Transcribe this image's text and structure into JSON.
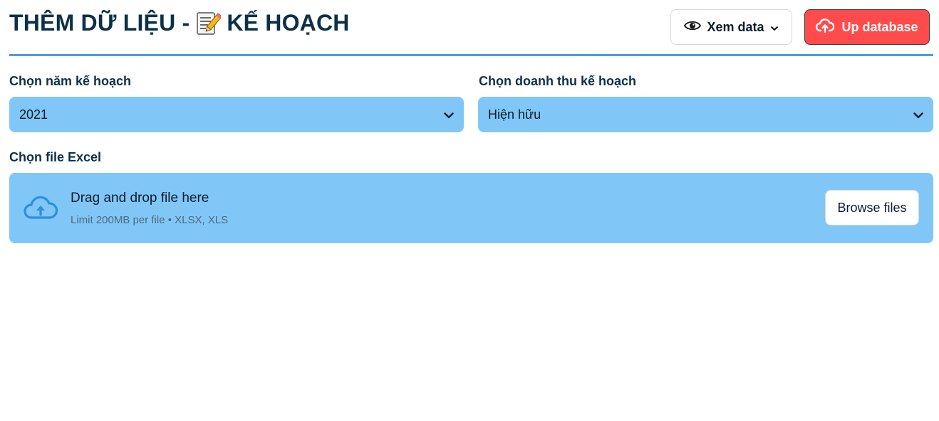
{
  "header": {
    "title_prefix": "THÊM DỮ LIỆU -",
    "title_suffix": "KẾ HOẠCH",
    "title_icon": "memo-icon",
    "view_button_label": "Xem data",
    "upload_button_label": "Up database"
  },
  "filters": {
    "year_label": "Chọn năm kế hoạch",
    "year_value": "2021",
    "revenue_label": "Chọn doanh thu kế hoạch",
    "revenue_value": "Hiện hữu"
  },
  "file_upload": {
    "label": "Chọn file Excel",
    "drop_title": "Drag and drop file here",
    "drop_hint": "Limit 200MB per file • XLSX, XLS",
    "browse_label": "Browse files"
  },
  "colors": {
    "accent_line": "#4a9be6",
    "input_bg": "#80c7f7",
    "upload_button": "#ff4b4b",
    "title_text": "#0c3146"
  }
}
